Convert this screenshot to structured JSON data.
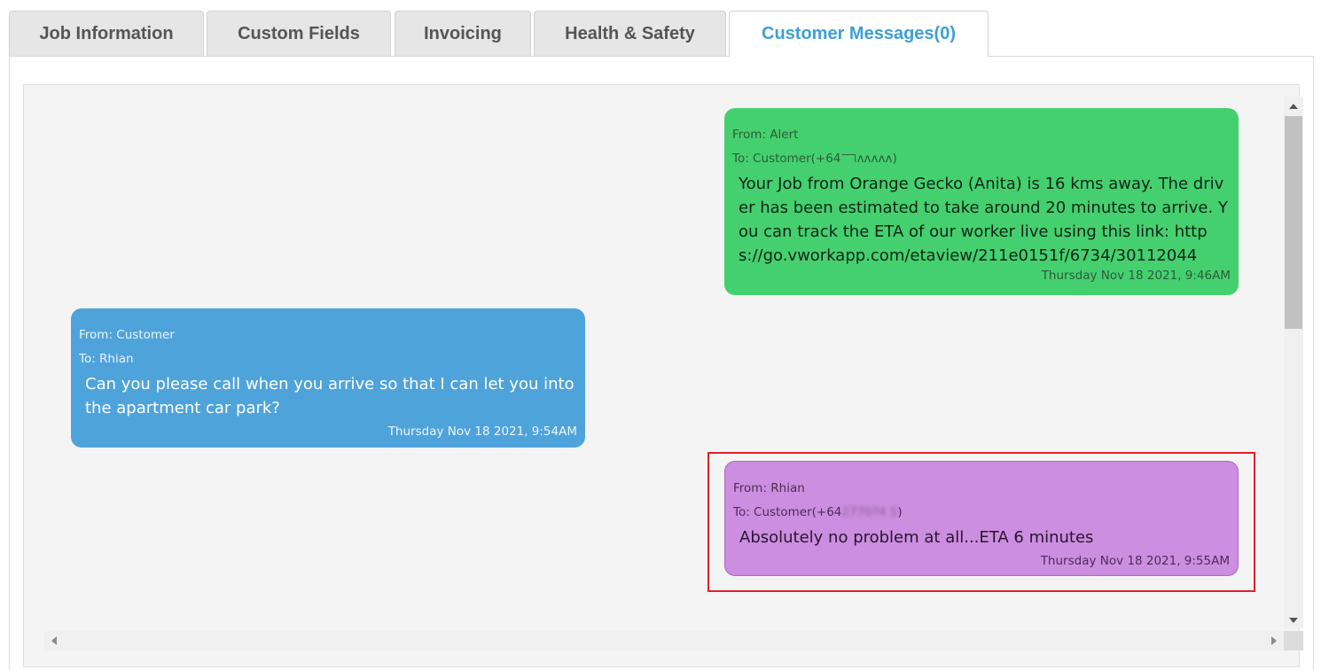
{
  "tabs": [
    {
      "label": "Job Information"
    },
    {
      "label": "Custom Fields"
    },
    {
      "label": "Invoicing"
    },
    {
      "label": "Health & Safety"
    },
    {
      "label": "Customer Messages(0)",
      "active": true
    }
  ],
  "messages": [
    {
      "from": "From: Alert",
      "to": "To: Customer(+64˥˥˥˥˥ᴧᴧᴧᴧᴧ)",
      "body": "Your Job from Orange Gecko (Anita) is 16 kms away. The driver has been estimated to take around 20 minutes to arrive. You can track the ETA of our worker live using this link: https://go.vworkapp.com/etaview/211e0151f/6734/30112044",
      "time": "Thursday Nov 18 2021, 9:46AM",
      "color": "#45d06f"
    },
    {
      "from": "From: Customer",
      "to": "To: Rhian",
      "body": "Can you please call when you arrive so that I can let you into the apartment car park?",
      "time": "Thursday Nov 18 2021, 9:54AM",
      "color": "#4fa3db"
    },
    {
      "from": "From: Rhian",
      "to_prefix": "To: Customer(+64",
      "to_redacted": "2770?4 5",
      "to_suffix": ")",
      "body": "Absolutely no problem at all...ETA 6 minutes",
      "time": "Thursday Nov 18 2021, 9:55AM",
      "color": "#cc8ee0",
      "highlighted": true,
      "highlight_color": "#e0202a"
    }
  ]
}
